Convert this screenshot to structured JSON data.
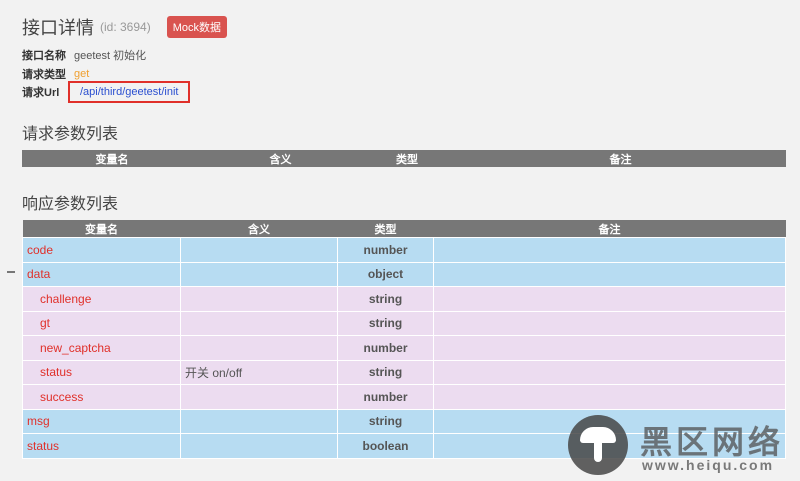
{
  "header": {
    "title": "接口详情",
    "id_text": "(id: 3694)",
    "mock_label": "Mock数据"
  },
  "info": {
    "name_label": "接口名称",
    "name_value": "geetest 初始化",
    "method_label": "请求类型",
    "method_value": "get",
    "url_label": "请求Url",
    "url_value": "/api/third/geetest/init"
  },
  "request_section": {
    "title": "请求参数列表",
    "headers": [
      "变量名",
      "含义",
      "类型",
      "备注"
    ]
  },
  "response_section": {
    "title": "响应参数列表",
    "headers": [
      "变量名",
      "含义",
      "类型",
      "备注"
    ],
    "rows": [
      {
        "name": "code",
        "meaning": "",
        "type": "number",
        "note": ""
      },
      {
        "name": "data",
        "meaning": "",
        "type": "object",
        "note": ""
      },
      {
        "name": "challenge",
        "meaning": "",
        "type": "string",
        "note": ""
      },
      {
        "name": "gt",
        "meaning": "",
        "type": "string",
        "note": ""
      },
      {
        "name": "new_captcha",
        "meaning": "",
        "type": "number",
        "note": ""
      },
      {
        "name": "status",
        "meaning": "开关 on/off",
        "type": "string",
        "note": ""
      },
      {
        "name": "success",
        "meaning": "",
        "type": "number",
        "note": ""
      },
      {
        "name": "msg",
        "meaning": "",
        "type": "string",
        "note": ""
      },
      {
        "name": "status",
        "meaning": "",
        "type": "boolean",
        "note": ""
      }
    ]
  },
  "watermark": {
    "chinese": "黑区网络",
    "url": "www.heiqu.com"
  }
}
